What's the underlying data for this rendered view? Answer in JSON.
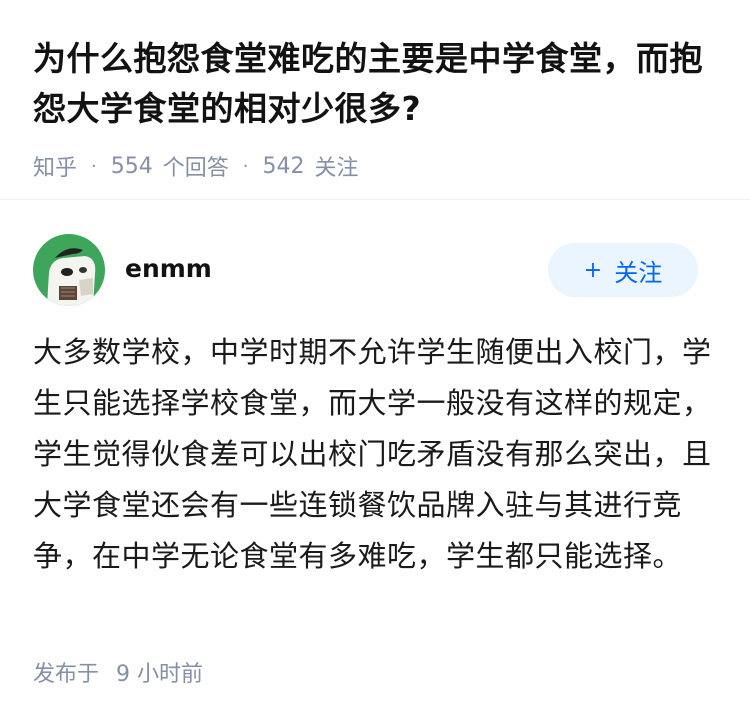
{
  "question": {
    "title": "为什么抱怨食堂难吃的主要是中学食堂，而抱怨大学食堂的相对少很多?",
    "source": "知乎",
    "answer_count": "554",
    "answer_label": "个回答",
    "follower_count": "542",
    "follower_label": "关注"
  },
  "author": {
    "name": "enmm",
    "follow_label": "关注",
    "follow_icon": "plus-icon"
  },
  "answer": {
    "text": "大多数学校，中学时期不允许学生随便出入校门，学生只能选择学校食堂，而大学一般没有这样的规定，学生觉得伙食差可以出校门吃矛盾没有那么突出，且大学食堂还会有一些连锁餐饮品牌入驻与其进行竞争，在中学无论食堂有多难吃，学生都只能选择。",
    "posted_label": "发布于",
    "posted_time": "9 小时前"
  },
  "colors": {
    "accent": "#0066ff",
    "button_bg": "#ebf5ff",
    "meta": "#8590a6",
    "avatar_bg": "#3ea65a"
  }
}
